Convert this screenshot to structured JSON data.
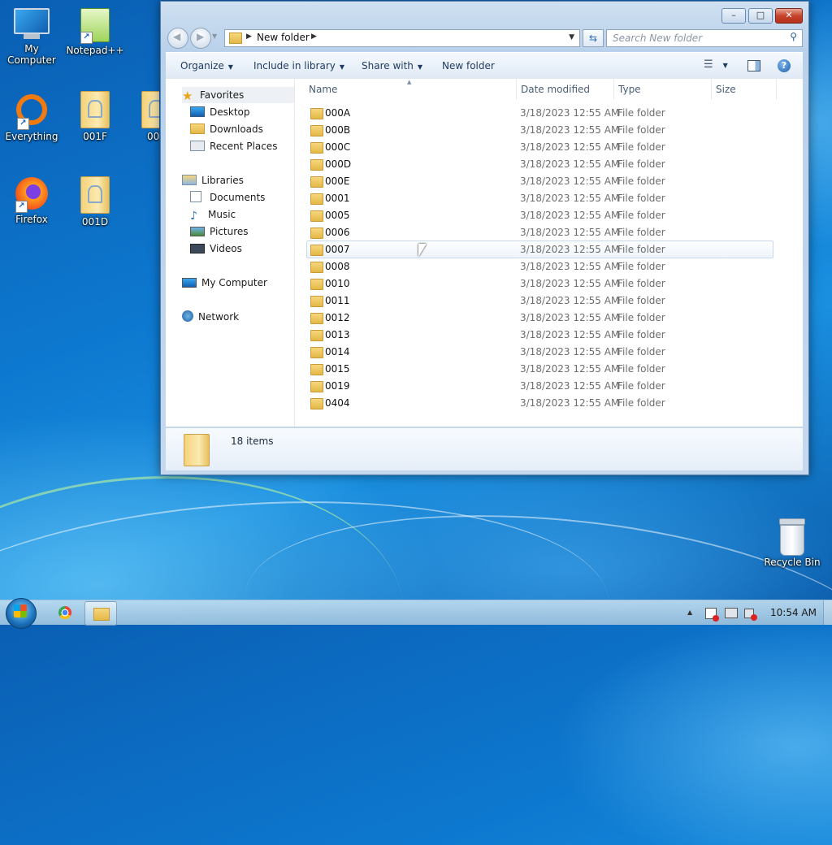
{
  "desktop": {
    "icons": [
      {
        "label": "My Computer"
      },
      {
        "label": "Notepad++"
      },
      {
        "label": "Everything"
      },
      {
        "label": "001F"
      },
      {
        "label": "00"
      },
      {
        "label": "Firefox"
      },
      {
        "label": "001D"
      },
      {
        "label": "Recycle Bin"
      }
    ]
  },
  "window": {
    "title_buttons": {
      "minimize": "–",
      "maximize": "□",
      "close": "✕"
    },
    "address": {
      "path": "New folder"
    },
    "search": {
      "placeholder": "Search New folder"
    },
    "toolbar": {
      "organize": "Organize",
      "include_in_library": "Include in library",
      "share_with": "Share with",
      "new_folder": "New folder"
    },
    "nav": {
      "favorites": "Favorites",
      "desktop": "Desktop",
      "downloads": "Downloads",
      "recent_places": "Recent Places",
      "libraries": "Libraries",
      "documents": "Documents",
      "music": "Music",
      "pictures": "Pictures",
      "videos": "Videos",
      "my_computer": "My Computer",
      "network": "Network"
    },
    "columns": {
      "name": "Name",
      "date_modified": "Date modified",
      "type": "Type",
      "size": "Size"
    },
    "files": [
      {
        "name": "000A",
        "date": "3/18/2023 12:55 AM",
        "type": "File folder"
      },
      {
        "name": "000B",
        "date": "3/18/2023 12:55 AM",
        "type": "File folder"
      },
      {
        "name": "000C",
        "date": "3/18/2023 12:55 AM",
        "type": "File folder"
      },
      {
        "name": "000D",
        "date": "3/18/2023 12:55 AM",
        "type": "File folder"
      },
      {
        "name": "000E",
        "date": "3/18/2023 12:55 AM",
        "type": "File folder"
      },
      {
        "name": "0001",
        "date": "3/18/2023 12:55 AM",
        "type": "File folder"
      },
      {
        "name": "0005",
        "date": "3/18/2023 12:55 AM",
        "type": "File folder"
      },
      {
        "name": "0006",
        "date": "3/18/2023 12:55 AM",
        "type": "File folder"
      },
      {
        "name": "0007",
        "date": "3/18/2023 12:55 AM",
        "type": "File folder"
      },
      {
        "name": "0008",
        "date": "3/18/2023 12:55 AM",
        "type": "File folder"
      },
      {
        "name": "0010",
        "date": "3/18/2023 12:55 AM",
        "type": "File folder"
      },
      {
        "name": "0011",
        "date": "3/18/2023 12:55 AM",
        "type": "File folder"
      },
      {
        "name": "0012",
        "date": "3/18/2023 12:55 AM",
        "type": "File folder"
      },
      {
        "name": "0013",
        "date": "3/18/2023 12:55 AM",
        "type": "File folder"
      },
      {
        "name": "0014",
        "date": "3/18/2023 12:55 AM",
        "type": "File folder"
      },
      {
        "name": "0015",
        "date": "3/18/2023 12:55 AM",
        "type": "File folder"
      },
      {
        "name": "0019",
        "date": "3/18/2023 12:55 AM",
        "type": "File folder"
      },
      {
        "name": "0404",
        "date": "3/18/2023 12:55 AM",
        "type": "File folder"
      }
    ],
    "status": {
      "item_count": "18 items"
    }
  },
  "taskbar": {
    "clock": "10:54 AM",
    "tray_arrow": "▲"
  },
  "colors": {
    "accent": "#2c6fb6",
    "close_button": "#c7432b"
  }
}
